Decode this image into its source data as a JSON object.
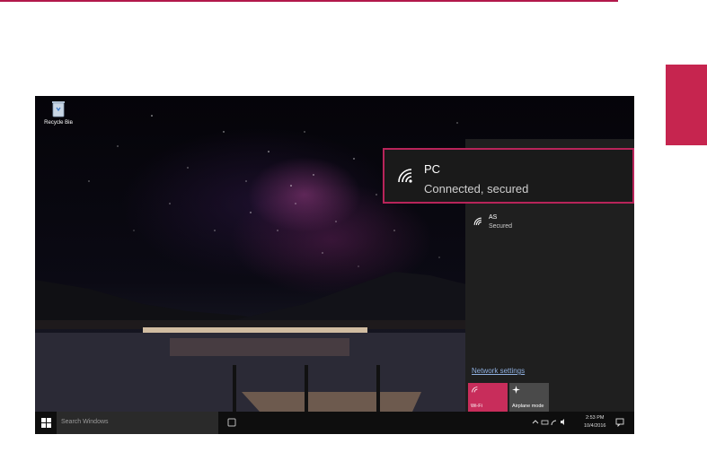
{
  "desktop": {
    "recycle_bin_label": "Recycle Bin"
  },
  "networks": [
    {
      "name": "PC",
      "status": "Connected, secured",
      "icon": "wifi-icon"
    },
    {
      "name": "AS",
      "status": "Secured",
      "icon": "wifi-icon"
    }
  ],
  "network_settings_label": "Network settings",
  "tiles": [
    {
      "label": "Wi-Fi",
      "icon": "wifi-icon",
      "color": "#c82d5b"
    },
    {
      "label": "Airplane mode",
      "icon": "airplane-icon",
      "color": "#4a4a4a"
    }
  ],
  "taskbar": {
    "search_placeholder": "Search Windows",
    "time": "2:53 PM",
    "date": "10/4/2016"
  },
  "colors": {
    "accent": "#c6254f",
    "highlight_border": "#b8245a"
  }
}
